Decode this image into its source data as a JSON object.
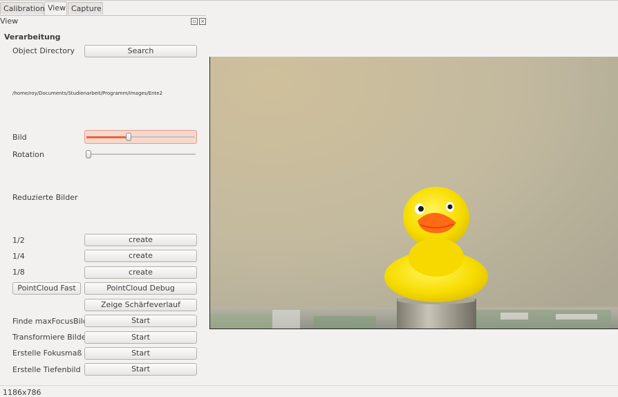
{
  "tabs": [
    "Calibration",
    "View",
    "Capture"
  ],
  "active_tab": "View",
  "dock": {
    "title": "View",
    "float_icon": "float-icon",
    "close_icon": "close-icon"
  },
  "section_title": "Verarbeitung",
  "object_directory": {
    "label": "Object Directory",
    "button": "Search",
    "path": "/home/roy/Documents/Studienarbeit/Programm/Images/Ente2"
  },
  "bild": {
    "label": "Bild",
    "value_fraction": 0.39
  },
  "rotation": {
    "label": "Rotation",
    "value_fraction": 0.0
  },
  "reduzierte_bilder": {
    "label": "Reduzierte Bilder",
    "rows": [
      {
        "label": "1/2",
        "button": "create"
      },
      {
        "label": "1/4",
        "button": "create"
      },
      {
        "label": "1/8",
        "button": "create"
      }
    ]
  },
  "pointcloud": {
    "fast": "PointCloud Fast",
    "debug": "PointCloud Debug"
  },
  "zeige": "Zeige Schärfeverlauf",
  "actions": [
    {
      "label": "Finde maxFocusBild",
      "button": "Start"
    },
    {
      "label": "Transformiere Bilder",
      "button": "Start"
    },
    {
      "label": "Erstelle Fokusmaß",
      "button": "Start"
    },
    {
      "label": "Erstelle Tiefenbild",
      "button": "Start"
    }
  ],
  "status": "1186x786",
  "colors": {
    "accent": "#e9643a",
    "background": "#f2f1f0"
  }
}
